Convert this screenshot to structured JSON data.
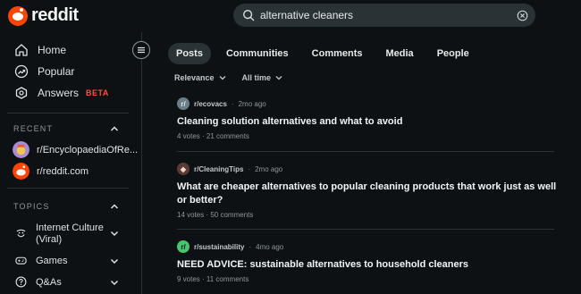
{
  "header": {
    "logo_text": "reddit",
    "search_value": "alternative cleaners"
  },
  "sidebar": {
    "nav": [
      {
        "label": "Home",
        "icon": "home-icon"
      },
      {
        "label": "Popular",
        "icon": "popular-icon"
      },
      {
        "label": "Answers",
        "icon": "answers-icon",
        "badge": "BETA"
      }
    ],
    "recent_title": "RECENT",
    "recent": [
      {
        "label": "r/EncyclopaediaOfRe..."
      },
      {
        "label": "r/reddit.com"
      }
    ],
    "topics_title": "TOPICS",
    "topics": [
      {
        "label_line1": "Internet Culture",
        "label_line2": "(Viral)",
        "icon": "smile-icon"
      },
      {
        "label_line1": "Games",
        "icon": "gamepad-icon"
      },
      {
        "label_line1": "Q&As",
        "icon": "qa-icon"
      }
    ]
  },
  "tabs": [
    "Posts",
    "Communities",
    "Comments",
    "Media",
    "People"
  ],
  "filters": {
    "sort": "Relevance",
    "time": "All time"
  },
  "posts": [
    {
      "subreddit": "r/ecovacs",
      "age": "2mo ago",
      "title": "Cleaning solution alternatives and what to avoid",
      "votes": "4 votes",
      "comments": "21 comments",
      "icon_color": "#6b7d87"
    },
    {
      "subreddit": "r/CleaningTips",
      "age": "2mo ago",
      "title": "What are cheaper alternatives to popular cleaning products that work just as well or better?",
      "votes": "14 votes",
      "comments": "50 comments",
      "icon_color": "#5a3a36"
    },
    {
      "subreddit": "r/sustainability",
      "age": "4mo ago",
      "title": "NEED ADVICE: sustainable alternatives to household cleaners",
      "votes": "9 votes",
      "comments": "11 comments",
      "icon_color": "#46c46f"
    }
  ],
  "colors": {
    "accent": "#ff4500",
    "background": "#0e1113",
    "beta": "#ff4f3a"
  }
}
